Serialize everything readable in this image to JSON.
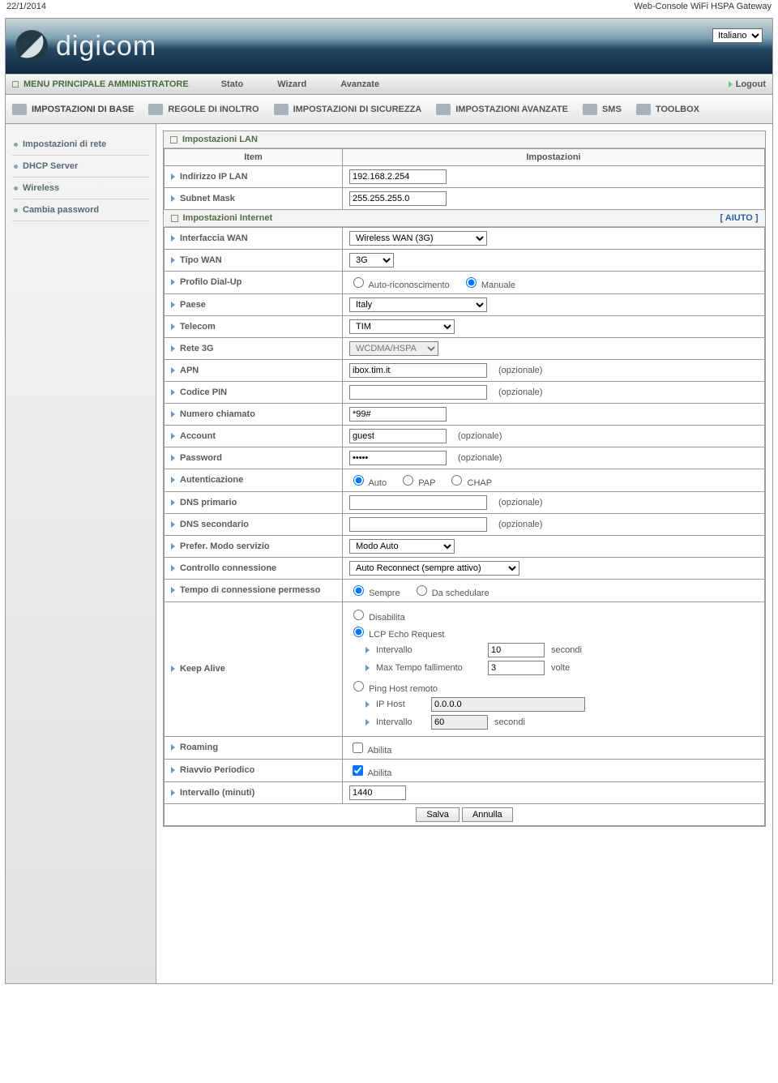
{
  "print_header": {
    "date": "22/1/2014",
    "title": "Web-Console WiFi HSPA Gateway"
  },
  "language": "Italiano",
  "logo_text": "digicom",
  "topmenu": {
    "admin": "MENU PRINCIPALE AMMINISTRATORE",
    "items": [
      "Stato",
      "Wizard",
      "Avanzate"
    ],
    "logout": "Logout"
  },
  "tabs": [
    "IMPOSTAZIONI DI BASE",
    "REGOLE DI INOLTRO",
    "IMPOSTAZIONI DI SICUREZZA",
    "IMPOSTAZIONI AVANZATE",
    "SMS",
    "TOOLBOX"
  ],
  "sidebar": [
    "Impostazioni di rete",
    "DHCP Server",
    "Wireless",
    "Cambia password"
  ],
  "sections": {
    "lan_title": "Impostazioni LAN",
    "net_title": "Impostazioni Internet",
    "help": "[ AIUTO ]"
  },
  "grid_headers": {
    "item": "Item",
    "settings": "Impostazioni"
  },
  "rows": {
    "ip_lan": {
      "label": "Indirizzo IP LAN",
      "value": "192.168.2.254"
    },
    "subnet": {
      "label": "Subnet Mask",
      "value": "255.255.255.0"
    },
    "wan_if": {
      "label": "Interfaccia WAN",
      "value": "Wireless WAN (3G)"
    },
    "wan_type": {
      "label": "Tipo WAN",
      "value": "3G"
    },
    "dialup": {
      "label": "Profilo Dial-Up",
      "opt_auto": "Auto-riconoscimento",
      "opt_manual": "Manuale"
    },
    "country": {
      "label": "Paese",
      "value": "Italy"
    },
    "telecom": {
      "label": "Telecom",
      "value": "TIM"
    },
    "rete3g": {
      "label": "Rete 3G",
      "value": "WCDMA/HSPA"
    },
    "apn": {
      "label": "APN",
      "value": "ibox.tim.it",
      "note": "(opzionale)"
    },
    "pin": {
      "label": "Codice PIN",
      "value": "",
      "note": "(opzionale)"
    },
    "dial": {
      "label": "Numero chiamato",
      "value": "*99#"
    },
    "account": {
      "label": "Account",
      "value": "guest",
      "note": "(opzionale)"
    },
    "password": {
      "label": "Password",
      "value": "•••••",
      "note": "(opzionale)"
    },
    "auth": {
      "label": "Autenticazione",
      "opts": [
        "Auto",
        "PAP",
        "CHAP"
      ]
    },
    "dns1": {
      "label": "DNS primario",
      "value": "",
      "note": "(opzionale)"
    },
    "dns2": {
      "label": "DNS secondario",
      "value": "",
      "note": "(opzionale)"
    },
    "prefer": {
      "label": "Prefer. Modo servizio",
      "value": "Modo Auto"
    },
    "connctrl": {
      "label": "Controllo connessione",
      "value": "Auto Reconnect (sempre attivo)"
    },
    "conntime": {
      "label": "Tempo di connessione permesso",
      "opt_always": "Sempre",
      "opt_sched": "Da schedulare"
    },
    "keepalive": {
      "label": "Keep Alive",
      "opt_disable": "Disabilita",
      "opt_lcp": "LCP Echo Request",
      "interval_lbl": "Intervallo",
      "interval_val": "10",
      "interval_unit": "secondi",
      "maxfail_lbl": "Max Tempo fallimento",
      "maxfail_val": "3",
      "maxfail_unit": "volte",
      "opt_ping": "Ping Host remoto",
      "iphost_lbl": "IP Host",
      "iphost_val": "0.0.0.0",
      "interval2_lbl": "Intervallo",
      "interval2_val": "60",
      "interval2_unit": "secondi"
    },
    "roaming": {
      "label": "Roaming",
      "chk": "Abilita"
    },
    "reboot": {
      "label": "Riavvio Periodico",
      "chk": "Abilita"
    },
    "reboot_int": {
      "label": "Intervallo (minuti)",
      "value": "1440"
    }
  },
  "buttons": {
    "save": "Salva",
    "cancel": "Annulla"
  }
}
